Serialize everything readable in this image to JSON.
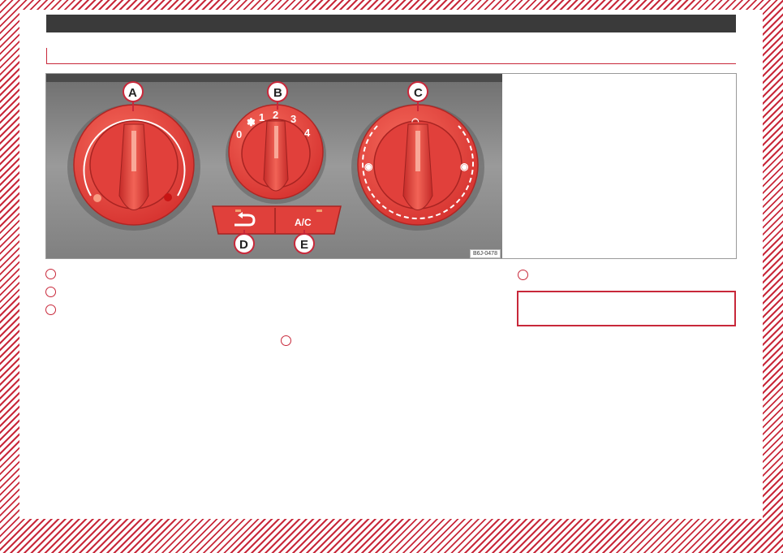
{
  "figure": {
    "code": "B6J-0478",
    "dial_b_scale": [
      "0",
      "1",
      "2",
      "3",
      "4"
    ],
    "button_ac": "A/C",
    "labels": {
      "a": "A",
      "b": "B",
      "c": "C",
      "d": "D",
      "e": "E"
    }
  },
  "colors": {
    "accent": "#c8283a",
    "knob": "#e8423f",
    "panel": "#8c8c8c"
  }
}
